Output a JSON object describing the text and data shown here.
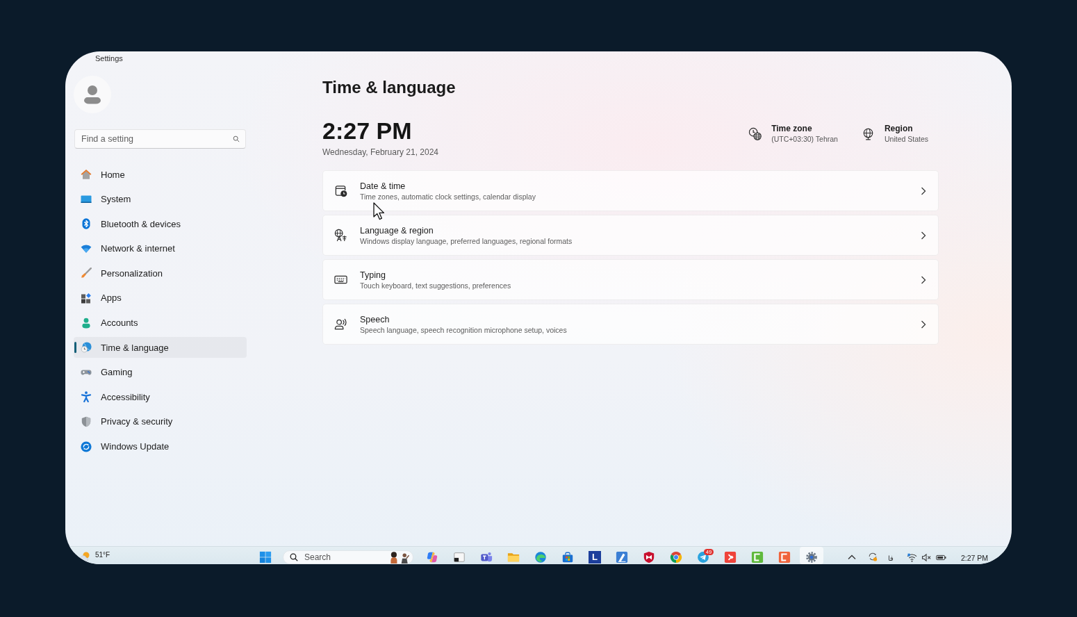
{
  "window": {
    "title": "Settings"
  },
  "sidebar": {
    "search": {
      "placeholder": "Find a setting"
    },
    "items": [
      {
        "kind": "home",
        "label": "Home",
        "selected": false
      },
      {
        "kind": "system",
        "label": "System",
        "selected": false
      },
      {
        "kind": "bluetooth",
        "label": "Bluetooth & devices",
        "selected": false
      },
      {
        "kind": "network",
        "label": "Network & internet",
        "selected": false
      },
      {
        "kind": "personalization",
        "label": "Personalization",
        "selected": false
      },
      {
        "kind": "apps",
        "label": "Apps",
        "selected": false
      },
      {
        "kind": "accounts",
        "label": "Accounts",
        "selected": false
      },
      {
        "kind": "time",
        "label": "Time & language",
        "selected": true
      },
      {
        "kind": "gaming",
        "label": "Gaming",
        "selected": false
      },
      {
        "kind": "accessibility",
        "label": "Accessibility",
        "selected": false
      },
      {
        "kind": "privacy",
        "label": "Privacy & security",
        "selected": false
      },
      {
        "kind": "update",
        "label": "Windows Update",
        "selected": false
      }
    ]
  },
  "page": {
    "title": "Time & language",
    "time": "2:27 PM",
    "date": "Wednesday, February 21, 2024",
    "details": [
      {
        "kind": "timezone",
        "label": "Time zone",
        "value": "(UTC+03:30) Tehran"
      },
      {
        "kind": "region",
        "label": "Region",
        "value": "United States"
      }
    ],
    "cards": [
      {
        "kind": "datetime",
        "title": "Date & time",
        "description": "Time zones, automatic clock settings, calendar display"
      },
      {
        "kind": "language",
        "title": "Language & region",
        "description": "Windows display language, preferred languages, regional formats"
      },
      {
        "kind": "typing",
        "title": "Typing",
        "description": "Touch keyboard, text suggestions, preferences"
      },
      {
        "kind": "speech",
        "title": "Speech",
        "description": "Speech language, speech recognition microphone setup, voices"
      }
    ]
  },
  "taskbar": {
    "weather": {
      "temperature": "51°F"
    },
    "search": {
      "placeholder": "Search"
    },
    "apps": [
      {
        "kind": "swirl",
        "selected": false
      },
      {
        "kind": "window",
        "selected": false
      },
      {
        "kind": "chat",
        "selected": false
      },
      {
        "kind": "folder",
        "selected": false
      },
      {
        "kind": "wave-browser",
        "selected": false
      },
      {
        "kind": "bag",
        "selected": false
      },
      {
        "kind": "letter",
        "glyph": "L",
        "selected": false
      },
      {
        "kind": "pen",
        "selected": false
      },
      {
        "kind": "shield",
        "selected": false
      },
      {
        "kind": "round-browser",
        "selected": false
      },
      {
        "kind": "plane",
        "badge": "49",
        "selected": false
      },
      {
        "kind": "diamond",
        "selected": false
      },
      {
        "kind": "bracket-green",
        "selected": false
      },
      {
        "kind": "bracket-orange",
        "selected": false
      },
      {
        "kind": "gear",
        "selected": true
      }
    ],
    "tray": {
      "language": "فا",
      "time": "2:27 PM"
    }
  }
}
